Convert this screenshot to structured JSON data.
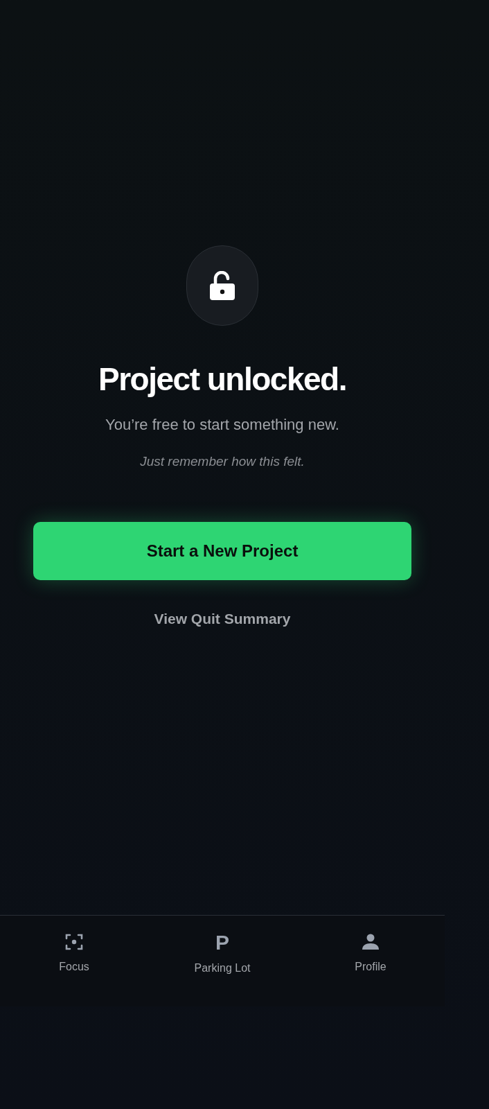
{
  "hero": {
    "title": "Project unlocked.",
    "subtitle": "You’re free to start something new.",
    "note": "Just remember how this felt."
  },
  "primary_button": "Start a New Project",
  "secondary_link": "View Quit Summary",
  "tab_bar": [
    {
      "kind": "focus",
      "label": "Focus"
    },
    {
      "kind": "parking",
      "label": "Parking Lot",
      "glyph": "P"
    },
    {
      "kind": "profile",
      "label": "Profile"
    }
  ]
}
